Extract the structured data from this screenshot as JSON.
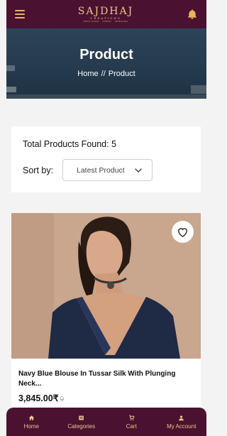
{
  "header": {
    "brand": "SAJDHAJ",
    "brand_sub": "CREATIONS",
    "tagline": "DRAP DANG · DIWALI · WEDDING"
  },
  "hero": {
    "title": "Product",
    "breadcrumb": {
      "home": "Home",
      "separator": "//",
      "current": "Product"
    }
  },
  "filters": {
    "total_text": "Total Products Found: 5",
    "sort_label": "Sort by:",
    "sort_value": "Latest Product"
  },
  "product": {
    "name": "Navy Blue Blouse In Tussar Silk With Plunging Neck...",
    "price": "3,845.00₹",
    "old_price": "0"
  },
  "bottom_nav": {
    "items": [
      {
        "label": "Home",
        "icon": "home-icon"
      },
      {
        "label": "Categories",
        "icon": "categories-icon"
      },
      {
        "label": "Cart",
        "icon": "cart-icon"
      },
      {
        "label": "My Account",
        "icon": "account-icon"
      }
    ]
  },
  "colors": {
    "primary": "#4a1230",
    "accent": "#e9b55a"
  }
}
